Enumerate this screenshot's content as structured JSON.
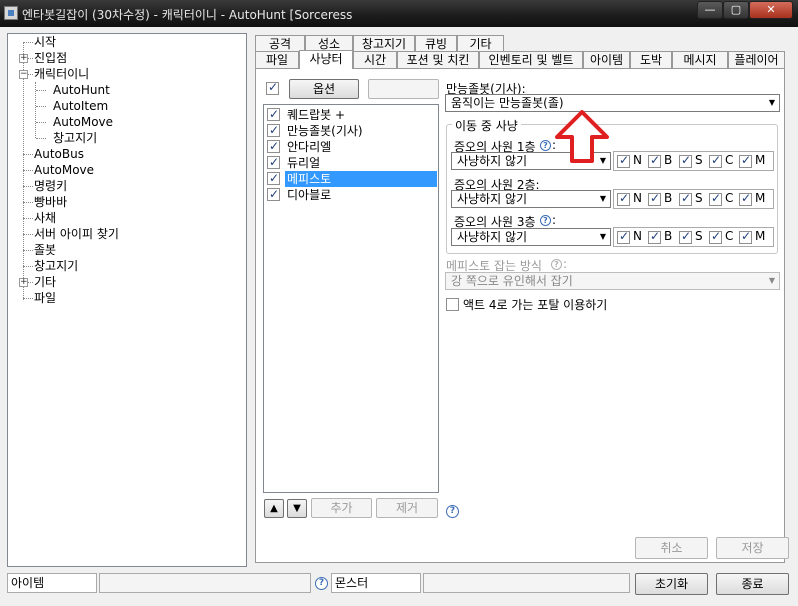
{
  "window": {
    "title": "엔타봇길잡이 (30차수정) - 캐릭터이니 - AutoHunt [Sorceress",
    "min_symbol": "—",
    "max_symbol": "▢",
    "close_symbol": "✕"
  },
  "tree": {
    "items": [
      {
        "label": "시작"
      },
      {
        "label": "진입점"
      },
      {
        "label": "캐릭터이니"
      },
      {
        "label": "AutoHunt"
      },
      {
        "label": "AutoItem"
      },
      {
        "label": "AutoMove"
      },
      {
        "label": "창고지기"
      },
      {
        "label": "AutoBus"
      },
      {
        "label": "AutoMove"
      },
      {
        "label": "명령키"
      },
      {
        "label": "빵바바"
      },
      {
        "label": "사채"
      },
      {
        "label": "서버 아이피 찾기"
      },
      {
        "label": "졸봇"
      },
      {
        "label": "창고지기"
      },
      {
        "label": "기타"
      },
      {
        "label": "파일"
      }
    ]
  },
  "tabs": {
    "row1": [
      "공격",
      "성소",
      "창고지기",
      "큐빙",
      "기타"
    ],
    "row2": [
      "파일",
      "사냥터",
      "시간",
      "포션 및 치킨",
      "인벤토리 및 벨트",
      "아이템",
      "도박",
      "메시지",
      "플레이어"
    ],
    "active": "사냥터"
  },
  "hunt": {
    "options_button": "옵션",
    "list": [
      {
        "label": "퀘드랍봇 +",
        "checked": true
      },
      {
        "label": "만능졸봇(기사)",
        "checked": true
      },
      {
        "label": "안다리엘",
        "checked": true
      },
      {
        "label": "듀리얼",
        "checked": true
      },
      {
        "label": "메피스토",
        "checked": true,
        "selected": true
      },
      {
        "label": "디아블로",
        "checked": true
      }
    ],
    "up_symbol": "▲",
    "down_symbol": "▼",
    "add_button": "추가",
    "remove_button": "제거"
  },
  "settings": {
    "section_label": "만능졸봇(기사):",
    "mode_value": "움직이는 만능졸봇(졸)",
    "moving_group_label": "이동 중 사냥",
    "acolytes": [
      {
        "label": "증오의 사원 1층",
        "value": "사냥하지 않기",
        "flags": [
          "N",
          "B",
          "S",
          "C",
          "M"
        ]
      },
      {
        "label": "증오의 사원 2층:",
        "value": "사냥하지 않기",
        "flags": [
          "N",
          "B",
          "S",
          "C",
          "M"
        ]
      },
      {
        "label": "증오의 사원 3층",
        "value": "사냥하지 않기",
        "flags": [
          "N",
          "B",
          "S",
          "C",
          "M"
        ]
      }
    ],
    "mephisto_method_label": "메피스토 잡는 방식",
    "mephisto_method_value": "강 쪽으로 유인해서 잡기",
    "act4_portal_label": "액트 4로 가는 포탈 이용하기",
    "help_symbol": "?"
  },
  "dialog": {
    "cancel": "취소",
    "save": "저장",
    "reset": "초기화",
    "close": "종료"
  },
  "statusbar": {
    "item_label": "아이템",
    "monster_label": "몬스터"
  },
  "annotation": {
    "arrow_color": "#e02020"
  }
}
